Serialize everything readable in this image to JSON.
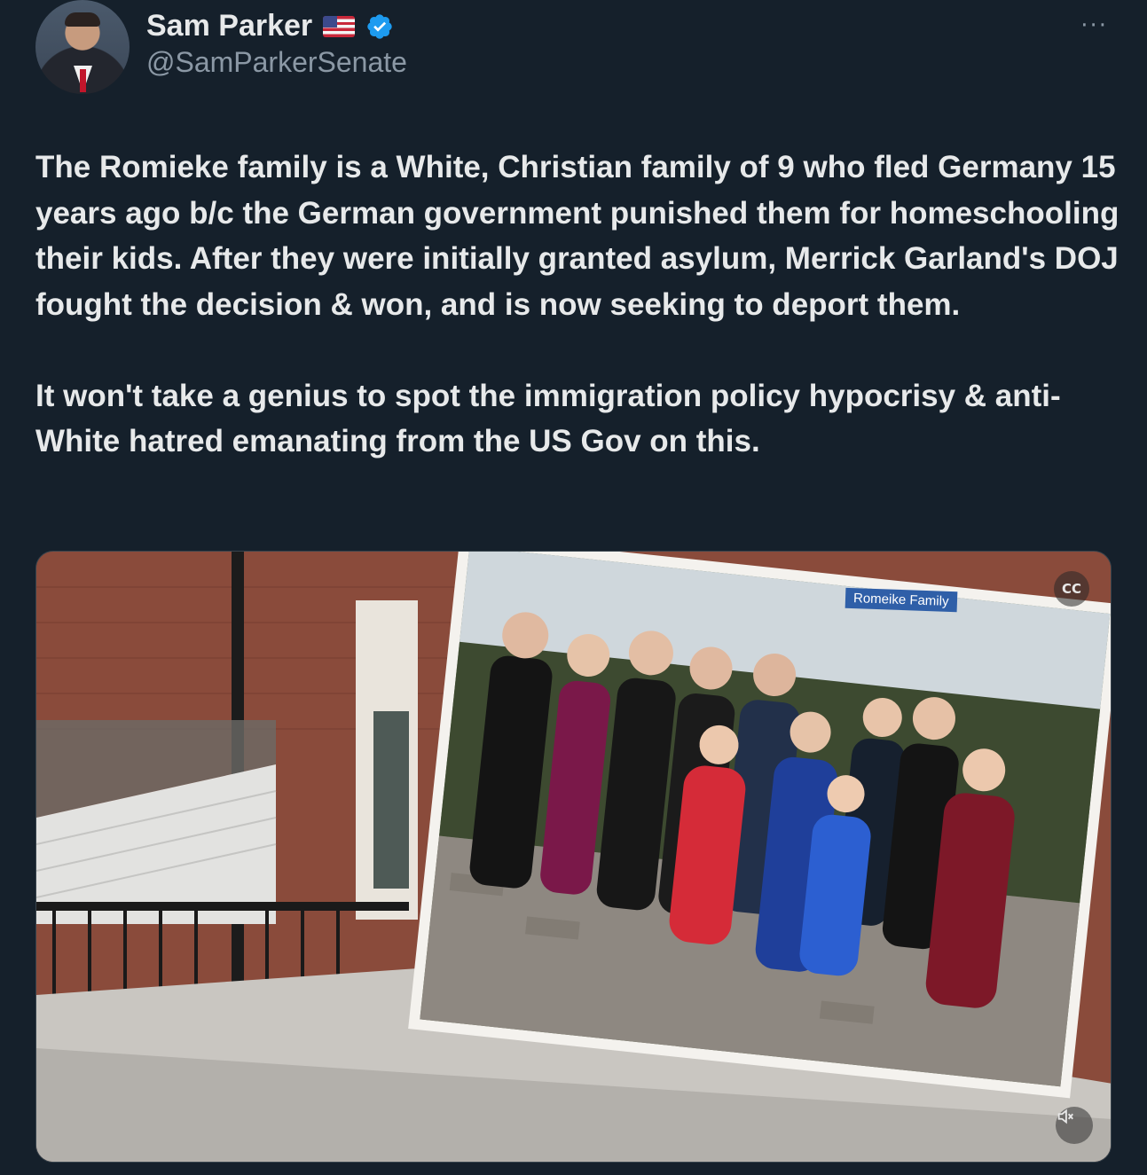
{
  "author": {
    "display_name": "Sam Parker",
    "flag_emoji": "🇺🇸",
    "handle": "@SamParkerSenate",
    "verified": true
  },
  "menu": {
    "more_label": "···"
  },
  "tweet": {
    "paragraphs": [
      "The Romieke family is a White, Christian family of 9 who fled Germany 15 years ago b/c the German government punished them for homeschooling their kids. After they were initially granted asylum, Merrick Garland's DOJ fought the decision & won, and is now seeking to deport them.",
      "It won't take a genius to spot the immigration policy hypocrisy & anti-White hatred emanating from the US Gov on this."
    ]
  },
  "media": {
    "caption_tag": "Romeike Family",
    "cc_icon": "closed-captions-off-icon",
    "mute_icon": "speaker-muted-icon"
  },
  "colors": {
    "background": "#15202b",
    "text": "#e7e9ea",
    "muted": "#8b98a5",
    "verified_blue": "#1d9bf0"
  }
}
